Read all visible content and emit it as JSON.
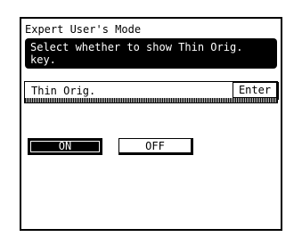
{
  "mode_title": "Expert User's Mode",
  "message": "Select whether to show Thin Orig. key.",
  "setting": {
    "label": "Thin Orig.",
    "enter_label": "Enter"
  },
  "options": {
    "on_label": "ON",
    "off_label": "OFF",
    "selected": "ON"
  },
  "colors": {
    "selected_bg": "#000000",
    "screen_bg": "#ffffff"
  }
}
